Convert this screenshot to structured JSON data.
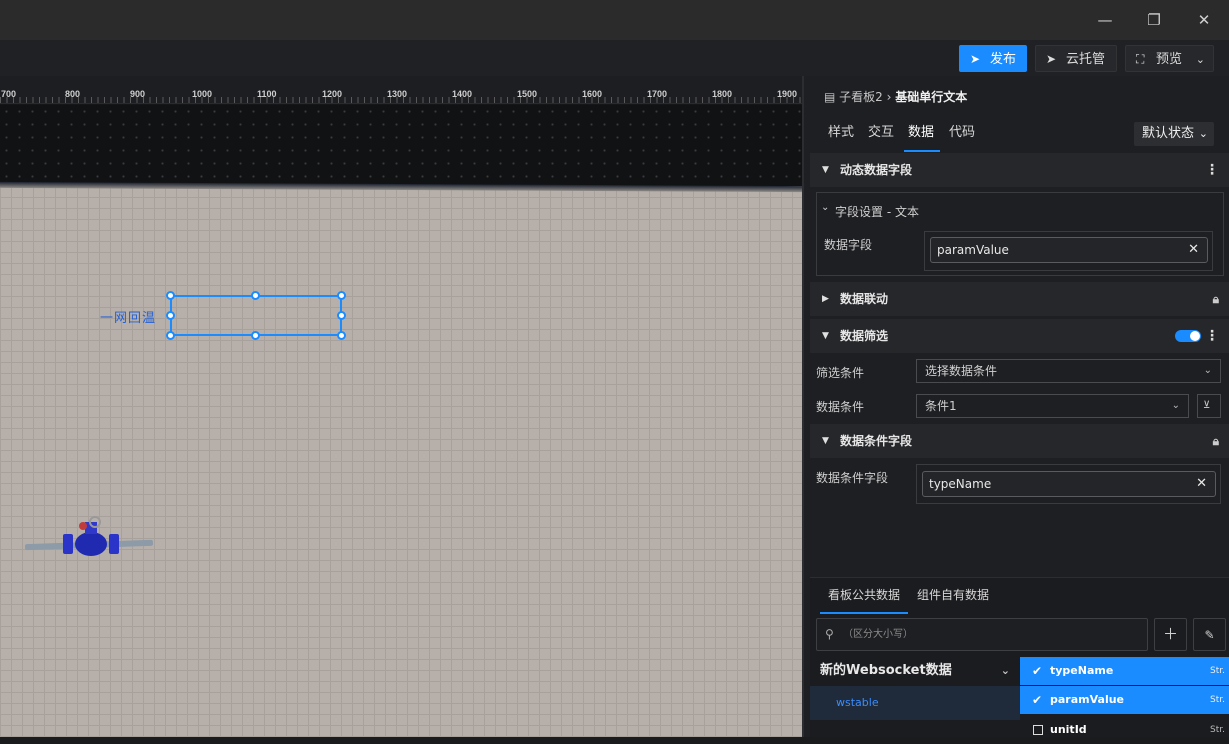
{
  "window": {
    "minimize": "—",
    "restore": "❐",
    "close": "✕"
  },
  "toolbar": {
    "publish": "发布",
    "cloud": "云托管",
    "preview": "预览"
  },
  "canvas": {
    "ruler_ticks": [
      "700",
      "800",
      "900",
      "1000",
      "1100",
      "1200",
      "1300",
      "1400",
      "1500",
      "1600",
      "1700",
      "1800",
      "1900"
    ],
    "selected_label": "一网回温"
  },
  "panel": {
    "breadcrumb_parent": "子看板2",
    "breadcrumb_sep": "›",
    "breadcrumb_current": "基础单行文本",
    "tabs": [
      "样式",
      "交互",
      "数据",
      "代码"
    ],
    "active_tab": "数据",
    "state_dropdown": "默认状态",
    "sections": {
      "dynamic_fields": "动态数据字段",
      "field_setting": "字段设置 - 文本",
      "data_field_label": "数据字段",
      "data_field_value": "paramValue",
      "linkage": "数据联动",
      "filter": "数据筛选",
      "filter_cond_label": "筛选条件",
      "filter_cond_placeholder": "选择数据条件",
      "data_cond_label": "数据条件",
      "data_cond_value": "条件1",
      "cond_fields": "数据条件字段",
      "cond_field_label": "数据条件字段",
      "cond_field_value": "typeName"
    },
    "bottom": {
      "tabs": [
        "看板公共数据",
        "组件自有数据"
      ],
      "search_placeholder": "（区分大小写）",
      "datasource_name": "新的Websocket数据",
      "datasource_item": "wstable",
      "fields": [
        {
          "name": "typeName",
          "type": "Str.",
          "checked": true
        },
        {
          "name": "paramValue",
          "type": "Str.",
          "checked": true
        },
        {
          "name": "unitId",
          "type": "Str.",
          "checked": false
        }
      ]
    }
  }
}
